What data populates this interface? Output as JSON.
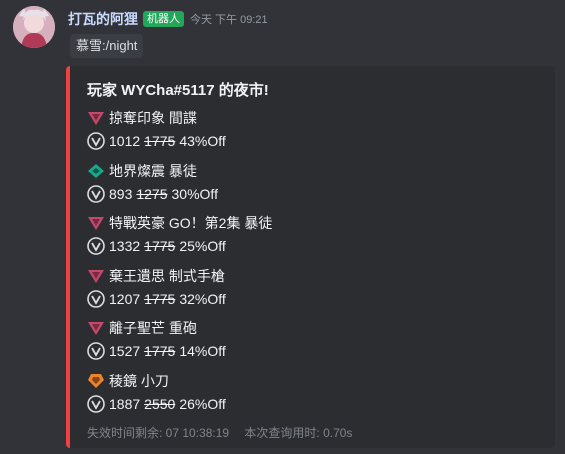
{
  "author": {
    "name": "打瓦的阿狸",
    "badge": "机器人",
    "timestamp": "今天 下午 09:21"
  },
  "command": "慕雪:/night",
  "embed": {
    "accent_color": "#f23f42",
    "title": "玩家 WYCha#5117 的夜市!",
    "items": [
      {
        "tier": "premium",
        "tier_color": "#c44a6b",
        "name": "掠奪印象 間諜",
        "price": "1012",
        "original": "1775",
        "discount": "43%Off"
      },
      {
        "tier": "select",
        "tier_color": "#1aa88c",
        "name": "地界燦震 暴徒",
        "price": "893",
        "original": "1275",
        "discount": "30%Off"
      },
      {
        "tier": "premium",
        "tier_color": "#c44a6b",
        "name": "特戰英豪 GO！第2集 暴徒",
        "price": "1332",
        "original": "1775",
        "discount": "25%Off"
      },
      {
        "tier": "premium",
        "tier_color": "#c44a6b",
        "name": "棄王遺思 制式手槍",
        "price": "1207",
        "original": "1775",
        "discount": "32%Off"
      },
      {
        "tier": "premium",
        "tier_color": "#c44a6b",
        "name": "離子聖芒 重砲",
        "price": "1527",
        "original": "1775",
        "discount": "14%Off"
      },
      {
        "tier": "exclusive",
        "tier_color": "#e8842b",
        "name": "稜鏡 小刀",
        "price": "1887",
        "original": "2550",
        "discount": "26%Off"
      }
    ],
    "footer": {
      "expiry": "失效时间剩余: 07 10:38:19",
      "query_time": "本次查询用时: 0.70s"
    }
  }
}
